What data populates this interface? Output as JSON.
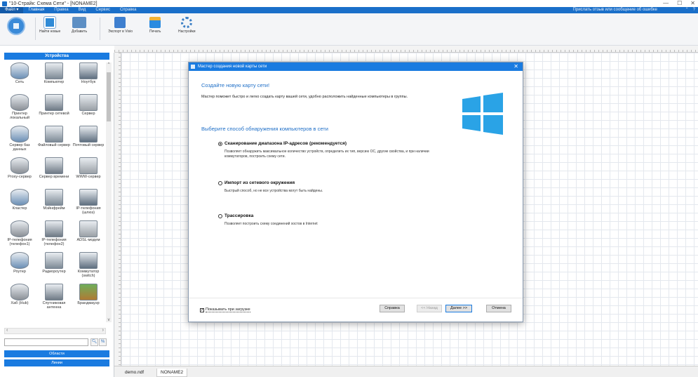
{
  "window": {
    "title": "\"10-Страйк: Схема Сети\" - [NONAME2]",
    "controls": [
      "—",
      "☐",
      "✕"
    ]
  },
  "menu": {
    "items": [
      "Файл ▾",
      "Главная",
      "Правка",
      "Вид",
      "Сервис",
      "Справка"
    ],
    "feedback": "Прислать отзыв или сообщение об ошибке",
    "icons": [
      "⌃",
      "?"
    ]
  },
  "ribbon": {
    "buttons": [
      {
        "label": "Найти новые",
        "icon": "find-new-icon"
      },
      {
        "label": "Добавить",
        "icon": "add-icon"
      },
      {
        "label": "Экспорт в Visio",
        "icon": "visio-export-icon"
      },
      {
        "label": "Печать",
        "icon": "print-icon"
      },
      {
        "label": "Настройки",
        "icon": "settings-icon"
      }
    ]
  },
  "left_panel": {
    "header": "Устройства",
    "devices": [
      {
        "label": "Сеть",
        "icon": "network-icon"
      },
      {
        "label": "Компьютер",
        "icon": "computer-icon"
      },
      {
        "label": "Ноутбук",
        "icon": "laptop-icon"
      },
      {
        "label": "Принтер локальный",
        "icon": "local-printer-icon"
      },
      {
        "label": "Принтер сетевой",
        "icon": "network-printer-icon"
      },
      {
        "label": "Сервер",
        "icon": "server-icon"
      },
      {
        "label": "Сервер баз данных",
        "icon": "database-server-icon"
      },
      {
        "label": "Файловый сервер",
        "icon": "file-server-icon"
      },
      {
        "label": "Почтовый сервер",
        "icon": "mail-server-icon"
      },
      {
        "label": "Proxy-сервер",
        "icon": "proxy-server-icon"
      },
      {
        "label": "Сервер времени",
        "icon": "time-server-icon"
      },
      {
        "label": "WWW-сервер",
        "icon": "www-server-icon"
      },
      {
        "label": "Кластер",
        "icon": "cluster-icon"
      },
      {
        "label": "Мэйнфрейм",
        "icon": "mainframe-icon"
      },
      {
        "label": "IP-телефония (шлюз)",
        "icon": "ip-gateway-icon"
      },
      {
        "label": "IP-телефония (телефон1)",
        "icon": "ip-phone1-icon"
      },
      {
        "label": "IP-телефония (телефон2)",
        "icon": "ip-phone2-icon"
      },
      {
        "label": "ADSL-модем",
        "icon": "adsl-modem-icon"
      },
      {
        "label": "Роутер",
        "icon": "router-icon"
      },
      {
        "label": "Радиороутер",
        "icon": "wireless-router-icon"
      },
      {
        "label": "Коммутатор (switch)",
        "icon": "switch-icon"
      },
      {
        "label": "Хаб (Hub)",
        "icon": "hub-icon"
      },
      {
        "label": "Спутниковая антенна",
        "icon": "satellite-dish-icon"
      },
      {
        "label": "Брандмауэр",
        "icon": "firewall-icon"
      }
    ],
    "search_placeholder": "",
    "tabs": [
      "Области",
      "Линии"
    ]
  },
  "doc_tabs": [
    "demo.ndf",
    "NONAME2"
  ],
  "dialog": {
    "title": "Мастер создания новой карты сети",
    "heading": "Создайте новую карту сети!",
    "intro": "Мастер поможет быстро и легко создать карту вашей сети, удобно расположить найденные компьютеры в группы.",
    "subheading": "Выберите способ обнаружения компьютеров в сети",
    "options": [
      {
        "title": "Сканирование диапазона IP-адресов (рекомендуется)",
        "description": "Позволяет обнаружить максимальное количество устройств, определить их тип, версию ОС, другие свойства, и при наличии коммутаторов, построить схему сети.",
        "selected": true
      },
      {
        "title": "Импорт из сетевого окружения",
        "description": "Быстрый способ, но не все устройства могут быть найдены.",
        "selected": false
      },
      {
        "title": "Трассировка",
        "description": "Позволяет построить схему соединений хостов в Internet",
        "selected": false
      }
    ],
    "show_on_startup": {
      "label": "Показывать при загрузке",
      "checked": true
    },
    "buttons": {
      "help": "Справка",
      "back": "<< Назад",
      "next": "Далее >>",
      "cancel": "Отмена"
    }
  },
  "colors": {
    "accent": "#1a7be0",
    "menu": "#1a6fc9",
    "heading": "#1f6fc7"
  }
}
